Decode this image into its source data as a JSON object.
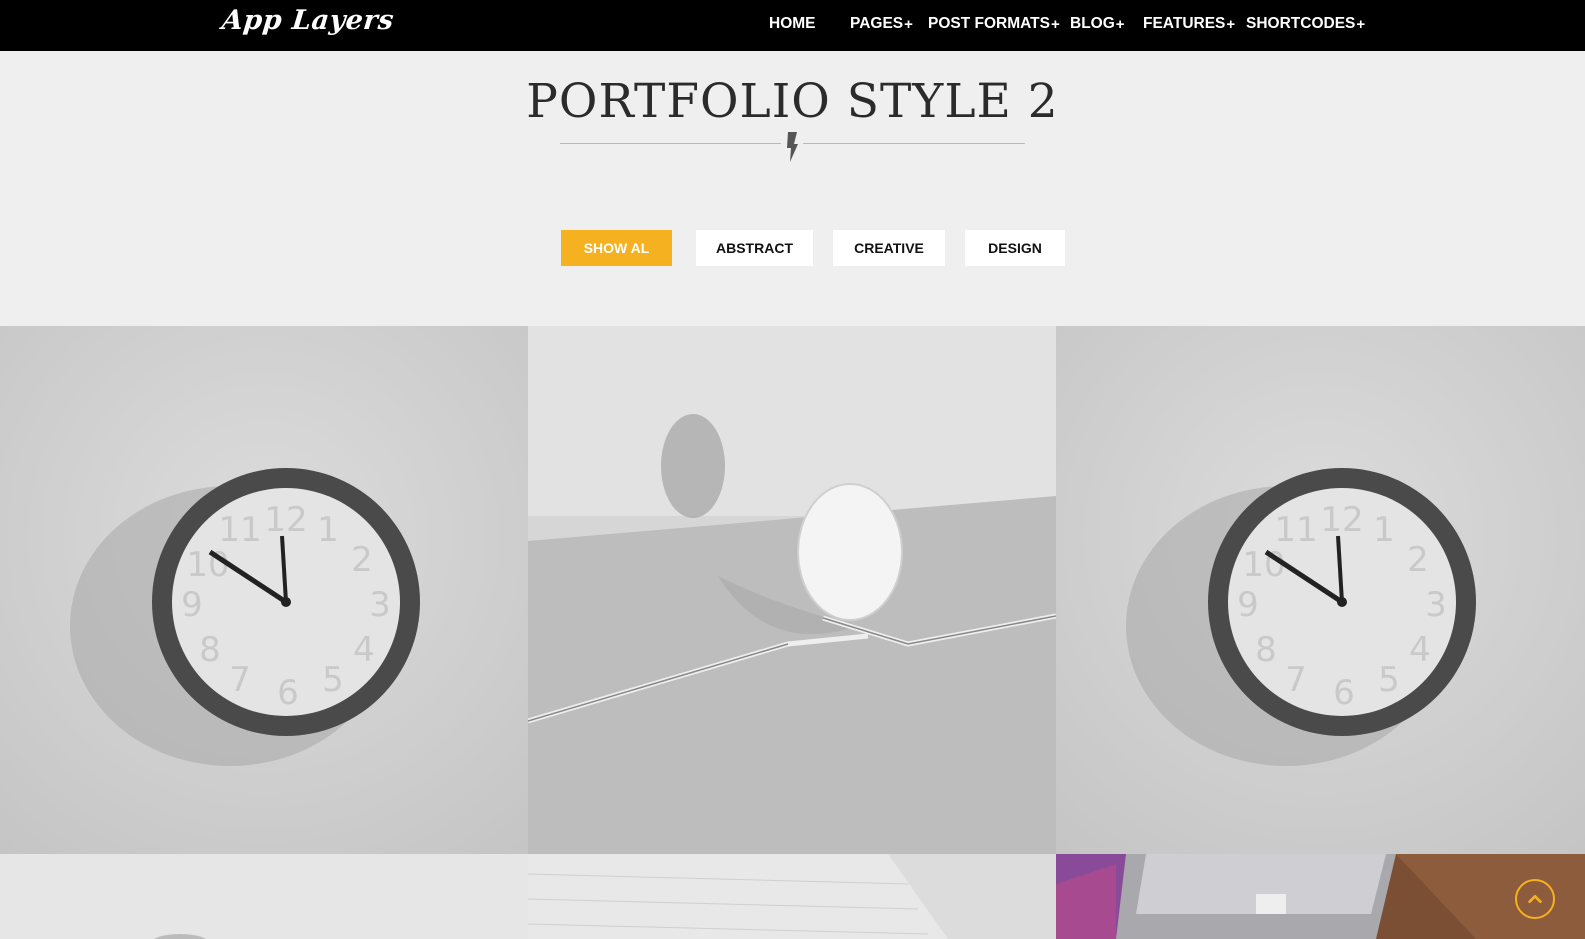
{
  "header": {
    "logo_text": "App Layers",
    "nav": [
      {
        "label": "HOME",
        "has_submenu": false
      },
      {
        "label": "PAGES",
        "has_submenu": true
      },
      {
        "label": "POST FORMATS",
        "has_submenu": true
      },
      {
        "label": "BLOG",
        "has_submenu": true
      },
      {
        "label": "FEATURES",
        "has_submenu": true
      },
      {
        "label": "SHORTCODES",
        "has_submenu": true
      }
    ],
    "submenu_glyph": "+"
  },
  "page": {
    "title": "PORTFOLIO STYLE 2",
    "divider_icon": "lightning-bolt-icon"
  },
  "filters": [
    {
      "label": "SHOW AL",
      "active": true
    },
    {
      "label": "ABSTRACT",
      "active": false
    },
    {
      "label": "CREATIVE",
      "active": false
    },
    {
      "label": "DESIGN",
      "active": false
    }
  ],
  "portfolio": {
    "items": [
      {
        "image": "wall-clock"
      },
      {
        "image": "egg-on-forks"
      },
      {
        "image": "wall-clock"
      },
      {
        "image": "grayscale-partial"
      },
      {
        "image": "paper-pages"
      },
      {
        "image": "laptop-on-wood"
      }
    ]
  },
  "scroll_top": {
    "icon": "chevron-up-icon"
  },
  "colors": {
    "accent": "#f5b120",
    "topbar": "#000000",
    "background": "#efefef"
  }
}
